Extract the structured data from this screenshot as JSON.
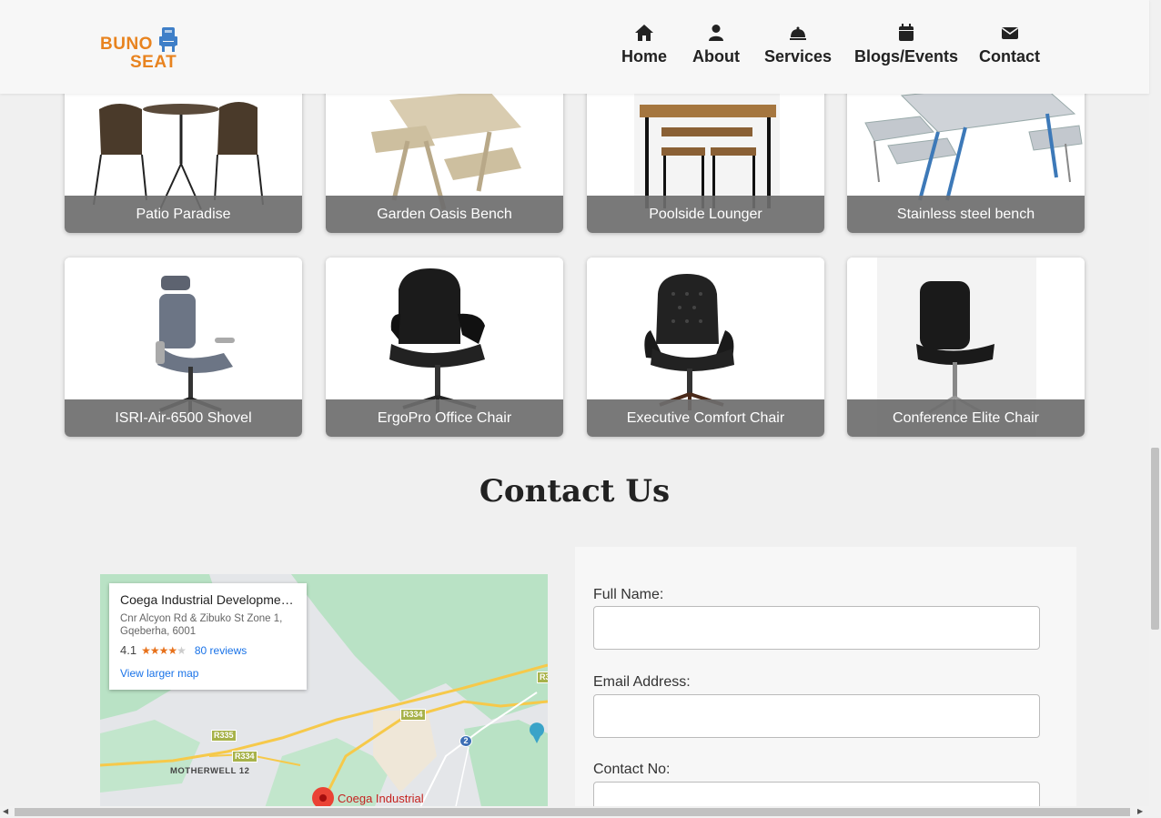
{
  "brand": {
    "line1": "BUNO",
    "line2": "SEAT",
    "color": "#e8831f"
  },
  "nav": [
    {
      "label": "Home",
      "icon": "home-icon"
    },
    {
      "label": "About",
      "icon": "user-icon"
    },
    {
      "label": "Services",
      "icon": "bell-icon"
    },
    {
      "label": "Blogs/Events",
      "icon": "calendar-icon"
    },
    {
      "label": "Contact",
      "icon": "envelope-icon"
    }
  ],
  "products": [
    {
      "name": "Patio Paradise"
    },
    {
      "name": "Garden Oasis Bench"
    },
    {
      "name": "Poolside Lounger"
    },
    {
      "name": "Stainless steel bench"
    },
    {
      "name": "ISRI-Air-6500 Shovel"
    },
    {
      "name": "ErgoPro Office Chair"
    },
    {
      "name": "Executive Comfort Chair"
    },
    {
      "name": "Conference Elite Chair"
    }
  ],
  "contact": {
    "title": "Contact Us",
    "map": {
      "place_name": "Coega Industrial Development...",
      "address_line1": "Cnr Alcyon Rd & Zibuko St Zone 1,",
      "address_line2": "Gqeberha, 6001",
      "rating": "4.1",
      "reviews": "80 reviews",
      "larger_map": "View larger map",
      "labels": {
        "r335": "R335",
        "r334a": "R334",
        "r334b": "R334",
        "r3": "R3",
        "route2": "2",
        "motherwell": "MOTHERWELL 12",
        "pin": "Coega Industrial"
      }
    },
    "form": {
      "full_name_label": "Full Name:",
      "email_label": "Email Address:",
      "contact_label": "Contact No:"
    }
  }
}
